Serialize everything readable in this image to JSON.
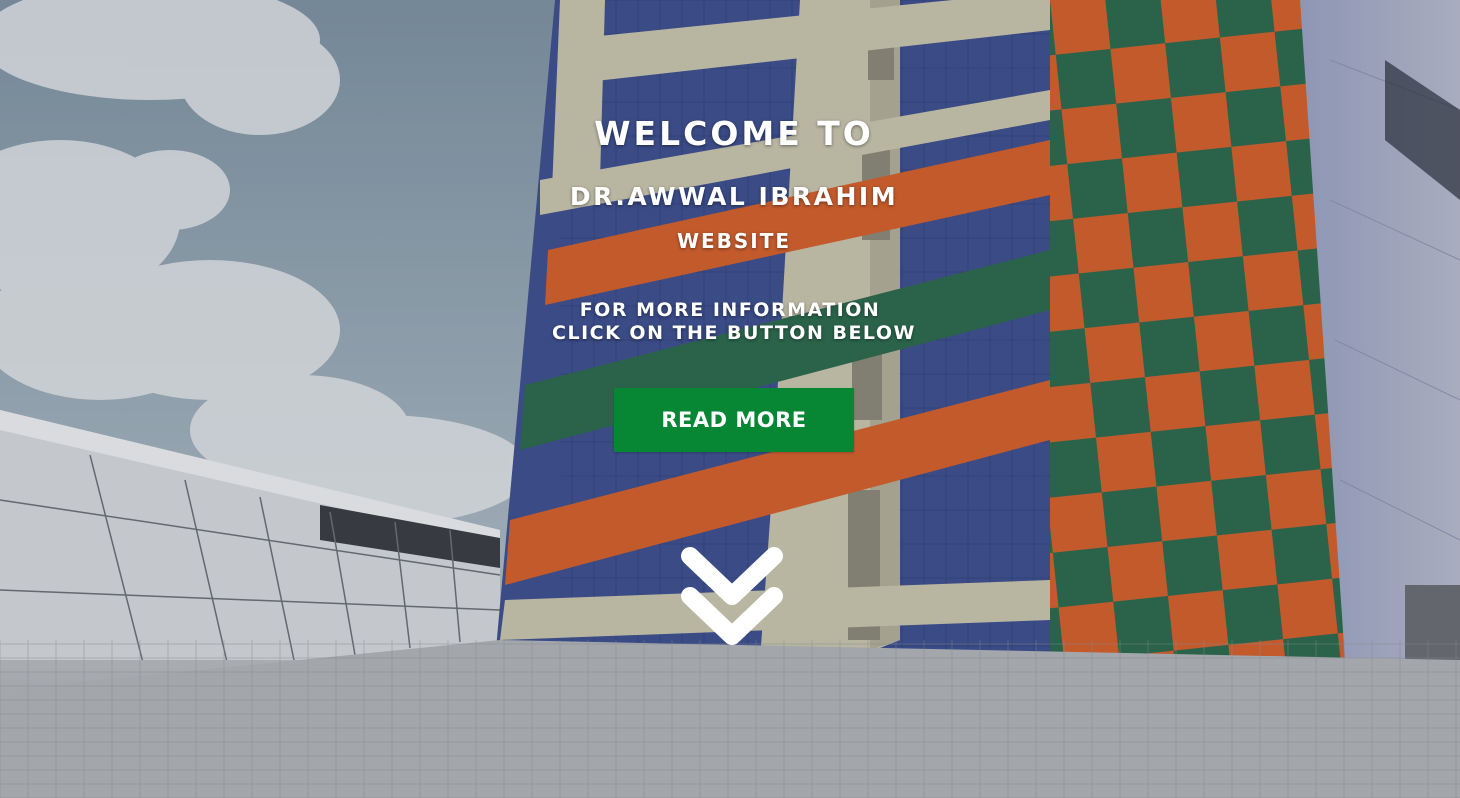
{
  "hero": {
    "welcome": "WELCOME TO",
    "name": "DR.AWWAL IBRAHIM",
    "website": "WEBSITE",
    "info_line1": "FOR MORE INFORMATION",
    "info_line2": "CLICK ON THE BUTTON BELOW",
    "button_label": "READ MORE",
    "scroll_icon": "double-chevron-down-icon"
  },
  "colors": {
    "button": "#078634",
    "text": "#ffffff",
    "building_orange": "#d4602c",
    "building_green": "#2b6a4d",
    "building_blue": "#3d5090",
    "building_beige": "#c9c6ae",
    "sky": "#8fa2b0"
  }
}
